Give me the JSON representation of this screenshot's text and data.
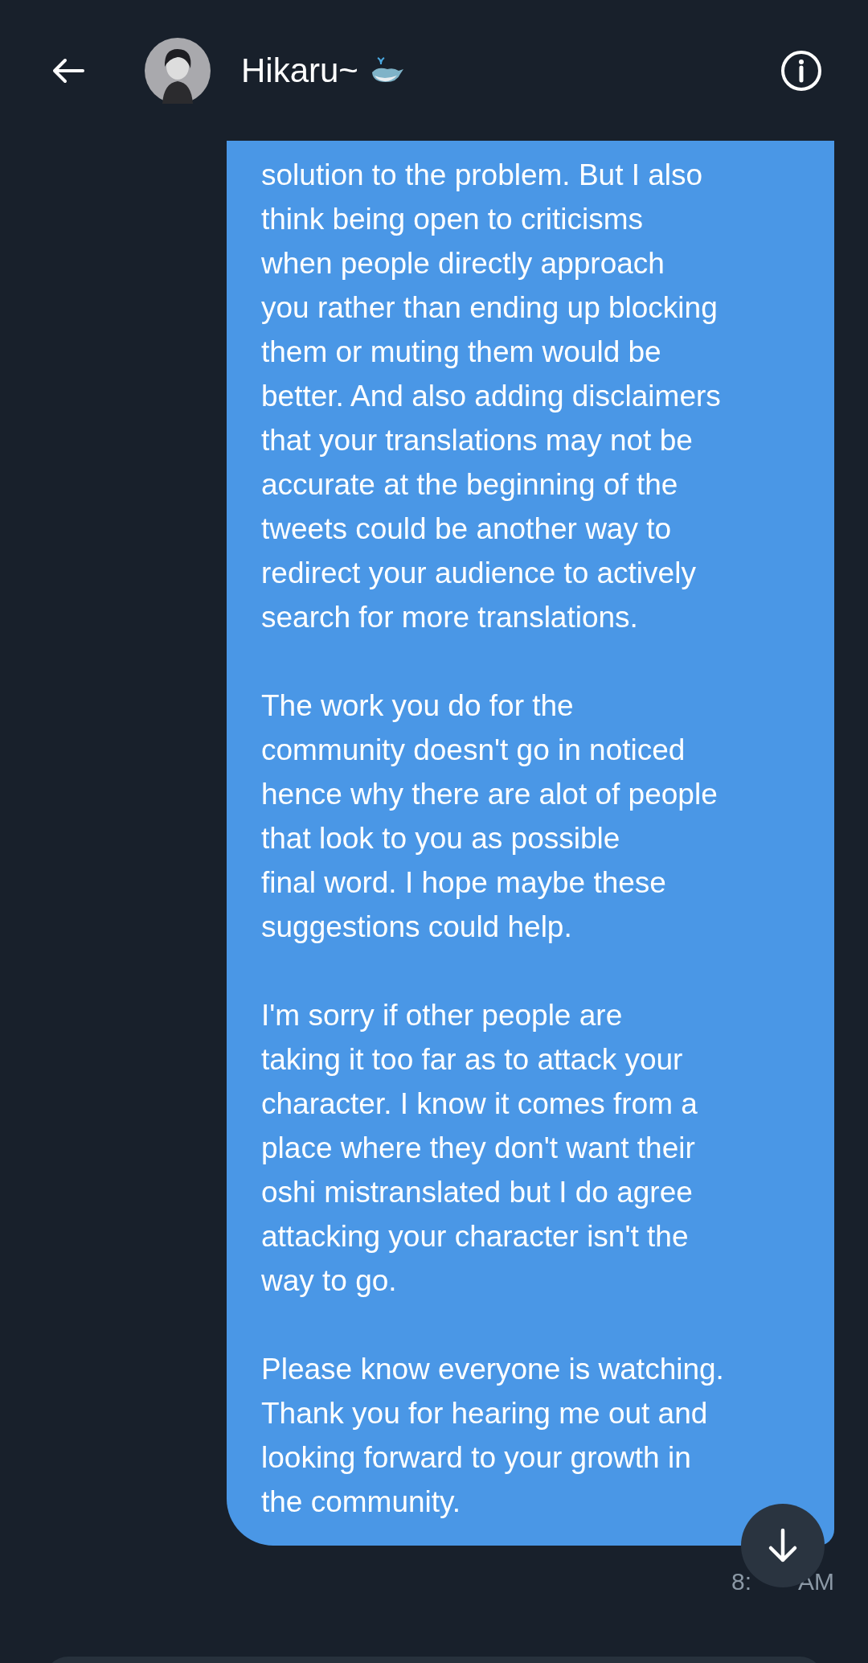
{
  "header": {
    "name": "Hikaru~"
  },
  "message": {
    "paragraphs": [
      [
        "solution to the problem. But I also",
        "think being open to criticisms",
        "when people directly approach",
        "you rather than ending up blocking",
        "them or muting them would be",
        "better. And also adding disclaimers",
        "that your translations may not be",
        "accurate at the beginning of the",
        "tweets could be another way to",
        "redirect your audience to actively",
        "search for more translations."
      ],
      [
        "The work you do for the",
        "community doesn't go in noticed",
        "hence why there are alot of people",
        "that look to you as possible",
        "final word. I hope maybe these",
        "suggestions could help."
      ],
      [
        "I'm sorry if other people are",
        "taking it too far as to attack your",
        "character. I know it comes from a",
        "place where they don't want their",
        "oshi mistranslated but I do agree",
        "attacking your character isn't the",
        "way to go."
      ],
      [
        "Please know everyone is watching.",
        "Thank you for hearing me out and",
        "looking forward to your growth in",
        "the community."
      ]
    ],
    "timestamp_parts": [
      "8:",
      "AM"
    ]
  }
}
